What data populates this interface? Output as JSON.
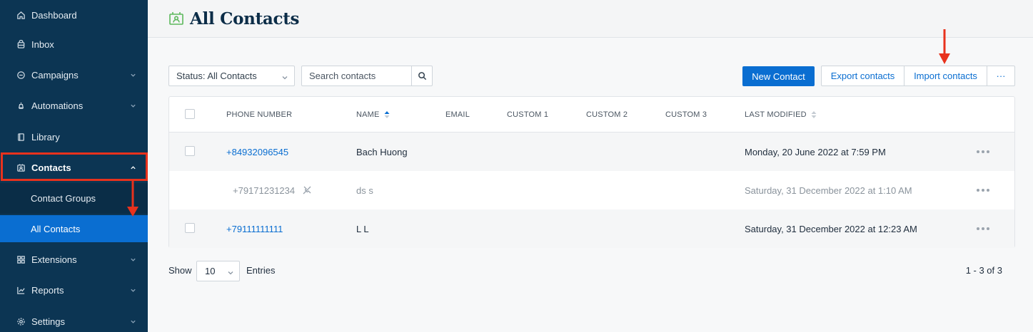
{
  "sidebar": {
    "items": [
      {
        "label": "Dashboard",
        "icon": "home-icon"
      },
      {
        "label": "Inbox",
        "icon": "inbox-icon"
      },
      {
        "label": "Campaigns",
        "icon": "campaign-icon"
      },
      {
        "label": "Automations",
        "icon": "automation-icon"
      },
      {
        "label": "Library",
        "icon": "library-icon"
      },
      {
        "label": "Contacts",
        "icon": "contacts-icon"
      },
      {
        "label": "Contact Groups"
      },
      {
        "label": "All Contacts"
      },
      {
        "label": "Extensions",
        "icon": "extensions-icon"
      },
      {
        "label": "Reports",
        "icon": "reports-icon"
      },
      {
        "label": "Settings",
        "icon": "settings-icon"
      }
    ]
  },
  "header": {
    "title": "All Contacts",
    "icon": "contact-card-icon"
  },
  "toolbar": {
    "status_value": "Status: All Contacts",
    "search_placeholder": "Search contacts",
    "new_contact_label": "New Contact",
    "export_label": "Export contacts",
    "import_label": "Import contacts",
    "more_label": "···"
  },
  "table": {
    "columns": [
      "PHONE NUMBER",
      "NAME",
      "EMAIL",
      "CUSTOM 1",
      "CUSTOM 2",
      "CUSTOM 3",
      "LAST MODIFIED"
    ],
    "rows": [
      {
        "phone": "+84932096545",
        "name": "Bach Huong",
        "email": "",
        "custom1": "",
        "custom2": "",
        "custom3": "",
        "modified": "Monday, 20 June 2022 at 7:59 PM"
      },
      {
        "phone": "+79171231234",
        "name": "ds s",
        "email": "",
        "custom1": "",
        "custom2": "",
        "custom3": "",
        "modified": "Saturday, 31 December 2022 at 1:10 AM"
      },
      {
        "phone": "+79111111111",
        "name": "L L",
        "email": "",
        "custom1": "",
        "custom2": "",
        "custom3": "",
        "modified": "Saturday, 31 December 2022 at 12:23 AM"
      }
    ]
  },
  "footer": {
    "show_label": "Show",
    "entries_value": "10",
    "entries_label": "Entries",
    "pagination_info": "1 - 3 of 3"
  },
  "colors": {
    "sidebar_bg": "#0c3553",
    "accent": "#0a6ed1",
    "annotation_red": "#e8321d"
  }
}
